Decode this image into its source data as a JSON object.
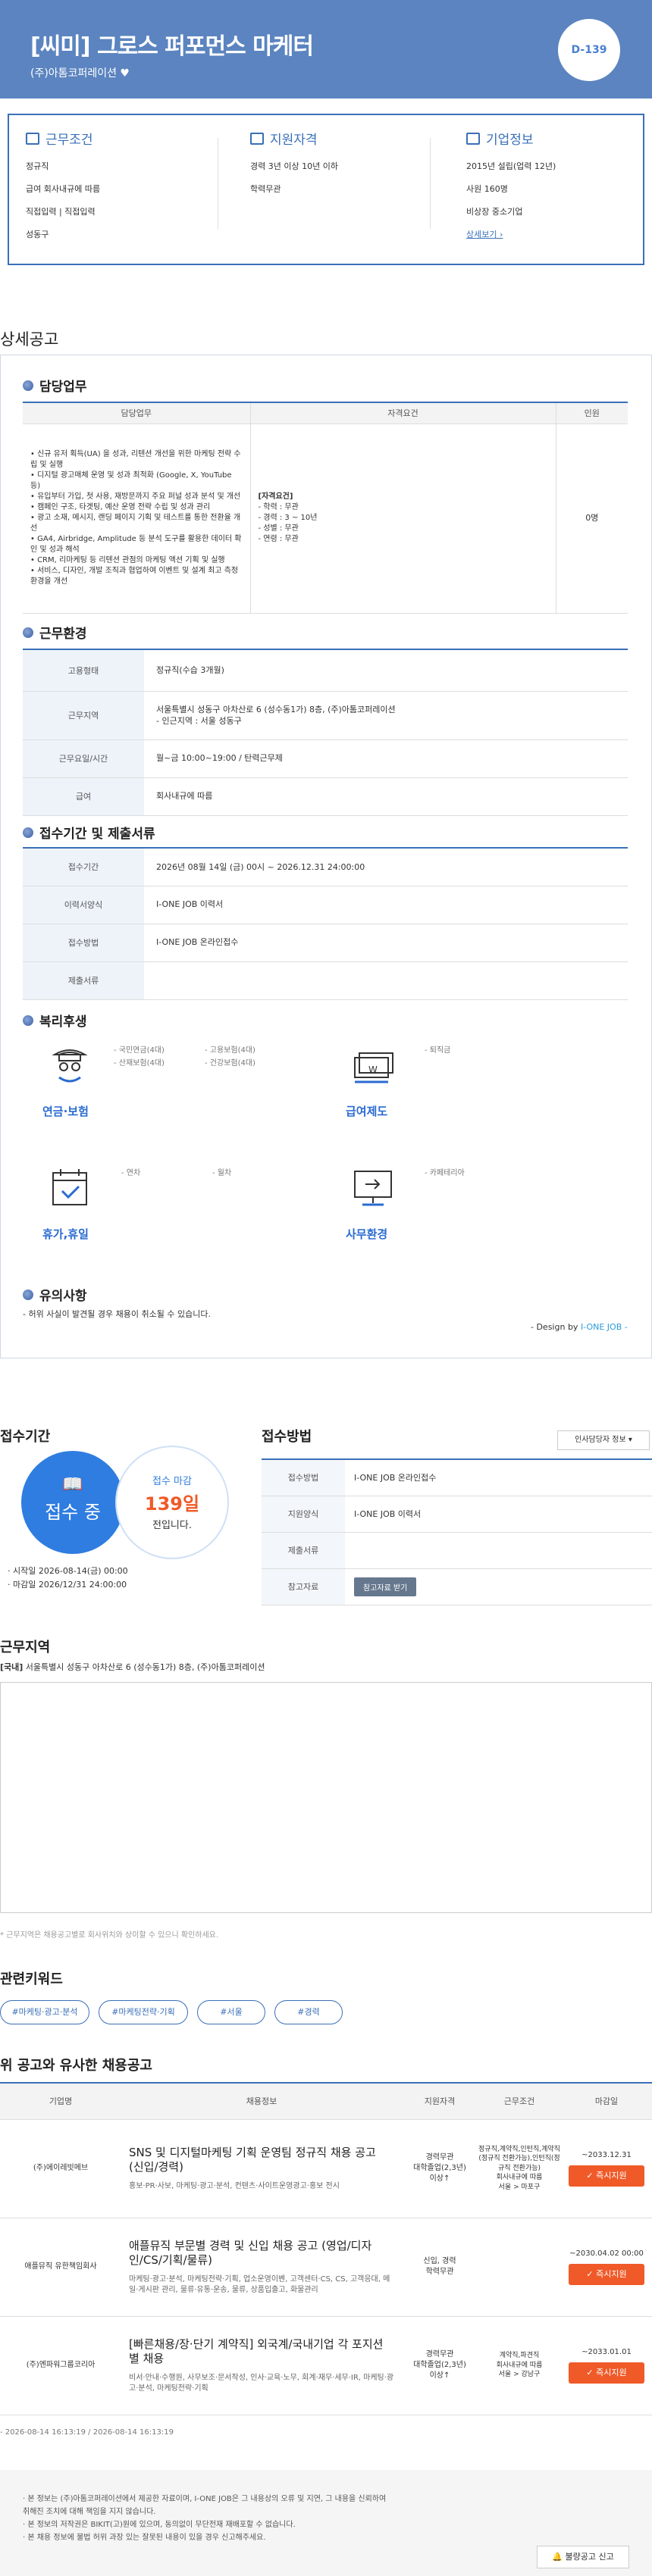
{
  "header": {
    "title": "[씨미] 그로스 퍼포먼스 마케터",
    "company": "(주)아톰코퍼레이션",
    "dday": "D-139"
  },
  "summary": {
    "conditions": {
      "title": "근무조건",
      "items": [
        "정규직",
        "급여 회사내규에 따름",
        "직접입력 | 직접입력",
        "성동구"
      ]
    },
    "qualifications": {
      "title": "지원자격",
      "items": [
        "경력 3년 이상 10년 이하",
        "학력무관"
      ]
    },
    "company_info": {
      "title": "기업정보",
      "items": [
        "2015년 설립(업력 12년)",
        "사원 160명",
        "비상장 중소기업"
      ],
      "link": "상세보기 ›"
    }
  },
  "detail": {
    "heading": "상세공고",
    "duty": {
      "heading": "담당업무",
      "headers": [
        "담당업무",
        "자격요건",
        "인원"
      ],
      "tasks": [
        "• 신규 유저 획득(UA) 을 성과, 리텐션 개선을 위한 마케팅 전략 수립 및 실행",
        "• 디지털 광고매체 운영 및 성과 최적화 (Google, X, YouTube 등)",
        "• 유입부터 가입, 첫 사용, 재방문까지 주요 퍼널 성과 분석 및 개선",
        "• 캠페인 구조, 타겟팅, 예산 운영 전략 수립 및 성과 관리",
        "• 광고 소재, 메시지, 랜딩 페이지 기획 및 테스트를 통한 전환율 개선",
        "• GA4, Airbridge, Amplitude 등 분석 도구를 활용한 데이터 확인 및 성과 해석",
        "• CRM, 리마케팅 등 리텐션 관점의 마케팅 액션 기획 및 실행",
        "• 서비스, 디자인, 개발 조직과 협업하여 이벤트 및 설계 최고 측정 환경을 개선"
      ],
      "requirements_title": "[자격요건]",
      "requirements": [
        "- 학력 : 무관",
        "- 경력 : 3 ~ 10년",
        "- 성별 : 무관",
        "- 연령 : 무관"
      ],
      "count": "0명"
    },
    "environment": {
      "heading": "근무환경",
      "rows": [
        {
          "label": "고용형태",
          "value": "정규직(수습 3개월)"
        },
        {
          "label": "근무지역",
          "value": "서울특별시 성동구 아차산로 6 (성수동1가) 8층, (주)아톰코퍼레이션\n- 인근지역 : 서울 성동구"
        },
        {
          "label": "근무요일/시간",
          "value": "월~금 10:00~19:00 / 탄력근무제"
        },
        {
          "label": "급여",
          "value": "회사내규에 따름"
        }
      ]
    },
    "submission": {
      "heading": "접수기간 및 제출서류",
      "rows": [
        {
          "label": "접수기간",
          "value": "2026년 08월 14일 (금) 00시 ~ 2026.12.31 24:00:00"
        },
        {
          "label": "이력서양식",
          "value": "I-ONE JOB 이력서"
        },
        {
          "label": "접수방법",
          "value": "I-ONE JOB 온라인접수"
        },
        {
          "label": "제출서류",
          "value": ""
        }
      ]
    },
    "benefits": {
      "heading": "복리후생",
      "groups": [
        {
          "label": "연금·보험",
          "icon": "pension-icon",
          "items": [
            "- 국민연금(4대)",
            "- 고용보험(4대)",
            "- 산재보험(4대)",
            "- 건강보험(4대)"
          ]
        },
        {
          "label": "급여제도",
          "icon": "salary-icon",
          "items": [
            "- 퇴직금"
          ]
        },
        {
          "label": "휴가,휴일",
          "icon": "vacation-icon",
          "items": [
            "- 연차",
            "- 월차"
          ]
        },
        {
          "label": "사무환경",
          "icon": "office-icon",
          "items": [
            "- 카페테리아"
          ]
        }
      ]
    },
    "notice": {
      "heading": "유의사항",
      "text": "- 허위 사실이 발견될 경우 채용이 취소될 수 있습니다."
    },
    "design_by": "- Design by ",
    "design_brand": "I-ONE JOB -"
  },
  "period": {
    "heading": "접수기간",
    "status": "접수 중",
    "remain_label": "접수 마감",
    "remain_days": "139일",
    "remain_suffix": "전입니다.",
    "start": "· 시작일 2026-08-14(금) 00:00",
    "end": "· 마감일 2026/12/31 24:00:00"
  },
  "apply": {
    "heading": "접수방법",
    "hr_button": "인사담당자 정보",
    "rows": [
      {
        "label": "접수방법",
        "value": "I-ONE JOB 온라인접수"
      },
      {
        "label": "지원양식",
        "value": "I-ONE JOB 이력서"
      },
      {
        "label": "제출서류",
        "value": ""
      },
      {
        "label": "참고자료",
        "value": ""
      }
    ],
    "ref_button": "참고자료 받기"
  },
  "location": {
    "heading": "근무지역",
    "tag": "[국내]",
    "address": "서울특별시 성동구 아차산로 6 (성수동1가) 8층, (주)아톰코퍼레이션",
    "note": "* 근무지역은 채용공고별로 회사위치와 상이할 수 있으니 확인하세요."
  },
  "keywords": {
    "heading": "관련키워드",
    "items": [
      "#마케팅·광고·분석",
      "#마케팅전략·기획",
      "#서울",
      "#경력"
    ]
  },
  "similar": {
    "heading": "위 공고와 유사한 채용공고",
    "headers": [
      "기업명",
      "채용정보",
      "지원자격",
      "근무조건",
      "마감일"
    ],
    "rows": [
      {
        "company": "(주)에이레빗메브",
        "title": "SNS 및 디지털마케팅 기획 운영팀 정규직 채용 공고 (신입/경력)",
        "desc": "홍보·PR·사보, 마케팅·광고·분석, 컨텐츠·사이트운영광고·홍보 전시",
        "qual": "경력무관\n대학졸업(2,3년)\n이상↑",
        "cond": "정규직,계약직,인턴직,계약직(정규직 전환가능),인턴직(정규직 전환가능)\n회사내규에 따름\n서울 > 마포구",
        "deadline": "~2033.12.31",
        "button": "✓ 즉시지원"
      },
      {
        "company": "애플뮤직 유한책임회사",
        "title": "애플뮤직 부문별 경력 및 신입 채용 공고 (영업/디자인/CS/기획/물류)",
        "desc": "마케팅·광고·분석, 마케팅전략·기획, 업소운영이벤, 고객센터·CS, CS, 고객응대, 메일·게시판 관리, 물류·유통·운송, 물류, 상품입출고, 화물관리",
        "qual": "신입, 경력\n학력무관",
        "cond": "",
        "deadline": "~2030.04.02 00:00",
        "button": "✓ 즉시지원"
      },
      {
        "company": "(주)엔파워그룹코리아",
        "title": "[빠른채용/장·단기 계약직] 외국계/국내기업 각 포지션 별 채용",
        "desc": "비서·안내·수행원, 사무보조·문서작성, 인사·교육·노무, 회계·재무·세무·IR, 마케팅·광고·분석, 마케팅전략·기획",
        "qual": "경력무관\n대학졸업(2,3년)\n이상↑",
        "cond": "계약직,파견직\n회사내규에 따름\n서울 > 강남구",
        "deadline": "~2033.01.01",
        "button": "✓ 즉시지원"
      }
    ],
    "dates": "- 2026-08-14 16:13:19 / 2026-08-14 16:13:19"
  },
  "footer": {
    "notes": [
      "· 본 정보는 (주)아톰코퍼레이션에서 제공한 자료이며, I-ONE JOB은 그 내용상의 오류 및 지연, 그 내용을 신뢰하여",
      "  취해진 조치에 대해 책임을 지지 않습니다.",
      "· 본 정보의 저작권은 BIKIT(고)원에 있으며, 동의없이 무단전재 재배포할 수 없습니다.",
      "· 본 채용 정보에 불법 허위 과장 있는 잘못된 내용이 있을 경우 신고해주세요."
    ],
    "report": "불량공고 신고"
  },
  "colors": {
    "header_bg": "#5b84c0",
    "primary": "#3a6fb8",
    "accent_blue": "#2f7de0",
    "apply_orange": "#f05a28"
  }
}
